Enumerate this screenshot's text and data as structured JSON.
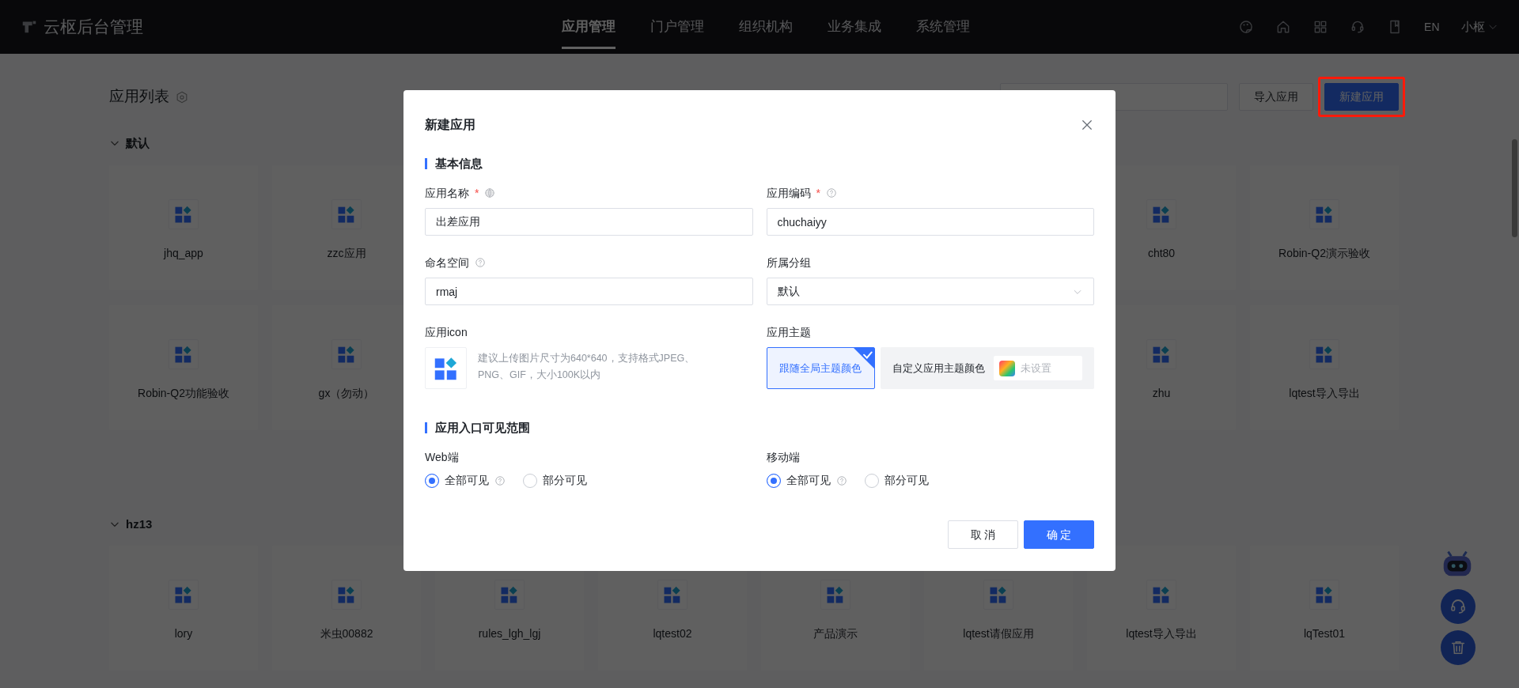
{
  "header": {
    "logo_text": "云枢后台管理",
    "nav": [
      {
        "label": "应用管理",
        "selected": true
      },
      {
        "label": "门户管理",
        "selected": false
      },
      {
        "label": "组织机构",
        "selected": false
      },
      {
        "label": "业务集成",
        "selected": false
      },
      {
        "label": "系统管理",
        "selected": false
      }
    ],
    "language": "EN",
    "user": "小枢"
  },
  "page": {
    "title": "应用列表",
    "buttons": [
      {
        "label": "导入应用",
        "kind": "default",
        "highlighted": false
      },
      {
        "label": "新建应用",
        "kind": "primary",
        "highlighted": true
      }
    ]
  },
  "groups": [
    {
      "name": "默认",
      "expanded": true,
      "rows": [
        [
          "jhq_app",
          "zzc应用",
          "cht80",
          "Robin-Q2演示验收"
        ],
        [
          "Robin-Q2功能验收",
          "gx（勿动）",
          "zhu",
          "lqtest导入导出"
        ]
      ]
    },
    {
      "name": "hz13",
      "expanded": true,
      "rows": [
        [
          "lory",
          "米虫00882",
          "rules_lgh_lgj",
          "lqtest02",
          "产品演示",
          "lqtest请假应用",
          "lqtest导入导出",
          "lqTest01"
        ]
      ]
    }
  ],
  "dialog": {
    "title": "新建应用",
    "sections": [
      {
        "title": "基本信息",
        "fields": [
          {
            "label": "应用名称",
            "kind": "input",
            "required_mark": "*",
            "language_icon": true,
            "help": false,
            "value": "出差应用"
          },
          {
            "label": "应用编码",
            "kind": "input",
            "required_mark": "*",
            "language_icon": false,
            "help": true,
            "value": "chuchaiyy"
          },
          {
            "label": "命名空间",
            "kind": "input",
            "language_icon": false,
            "help": true,
            "value": "rmaj"
          },
          {
            "label": "所属分组",
            "kind": "select",
            "language_icon": false,
            "help": false,
            "value": "默认"
          },
          {
            "label": "应用icon",
            "kind": "icon",
            "hint": "建议上传图片尺寸为640*640，支持格式JPEG、PNG、GIF，大小100K以内"
          },
          {
            "label": "应用主题",
            "kind": "theme",
            "options": [
              {
                "label": "跟随全局主题颜色",
                "selected": true
              },
              {
                "label": "自定义应用主题颜色",
                "selected": false,
                "placeholder": "未设置"
              }
            ]
          }
        ]
      },
      {
        "title": "应用入口可见范围",
        "fields": [
          {
            "label": "Web端",
            "kind": "radio",
            "options": [
              {
                "label": "全部可见",
                "help": true,
                "selected": true
              },
              {
                "label": "部分可见",
                "help": false,
                "selected": false
              }
            ]
          },
          {
            "label": "移动端",
            "kind": "radio",
            "options": [
              {
                "label": "全部可见",
                "help": true,
                "selected": true
              },
              {
                "label": "部分可见",
                "help": false,
                "selected": false
              }
            ]
          }
        ]
      }
    ],
    "buttons": [
      {
        "label": "取 消",
        "kind": "default"
      },
      {
        "label": "确 定",
        "kind": "primary"
      }
    ]
  }
}
